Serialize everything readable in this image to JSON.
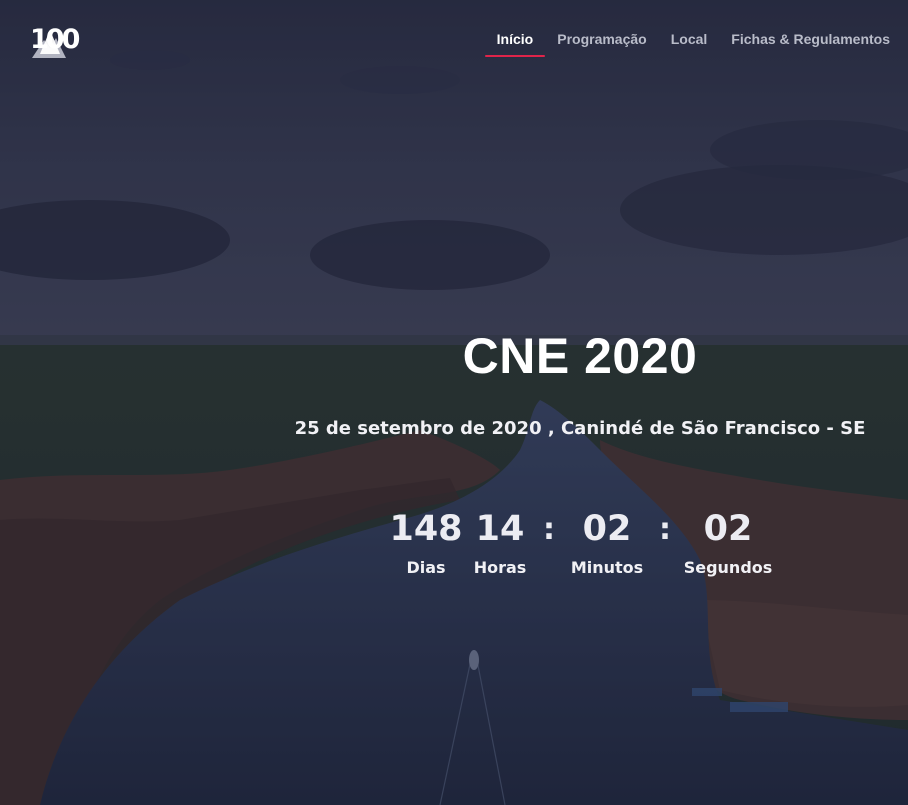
{
  "brand": {
    "logo_text": "100"
  },
  "nav": {
    "items": [
      {
        "label": "Início",
        "active": true
      },
      {
        "label": "Programação",
        "active": false
      },
      {
        "label": "Local",
        "active": false
      },
      {
        "label": "Fichas & Regulamentos",
        "active": false
      }
    ]
  },
  "hero": {
    "title": "CNE 2020",
    "subtitle": "25 de setembro de 2020 , Canindé de São Francisco - SE"
  },
  "countdown": {
    "days": {
      "value": "148",
      "label": "Dias"
    },
    "hours": {
      "value": "14",
      "label": "Horas"
    },
    "minutes": {
      "value": "02",
      "label": "Minutos"
    },
    "seconds": {
      "value": "02",
      "label": "Segundos"
    },
    "separator": ":"
  },
  "colors": {
    "accent": "#e0244a",
    "overlay": "#1e2034"
  }
}
